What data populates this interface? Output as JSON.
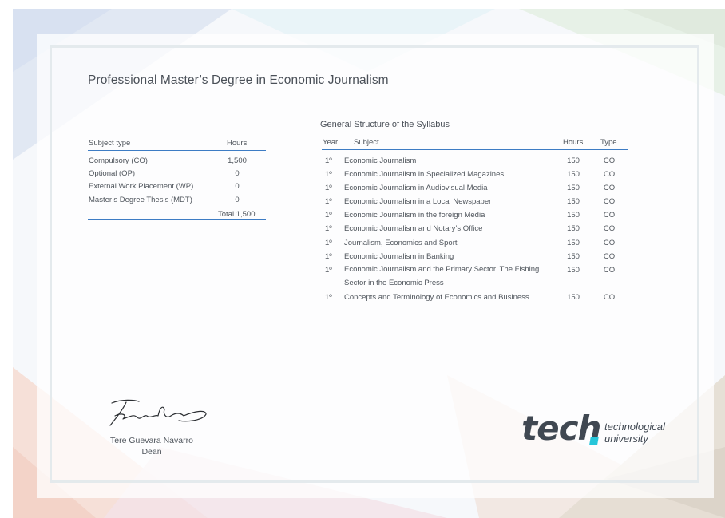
{
  "document": {
    "title": "Professional Master’s Degree in Economic Journalism"
  },
  "subject_summary": {
    "headers": {
      "type": "Subject type",
      "hours": "Hours"
    },
    "rows": [
      {
        "type": "Compulsory (CO)",
        "hours": "1,500"
      },
      {
        "type": "Optional (OP)",
        "hours": "0"
      },
      {
        "type": "External Work Placement (WP)",
        "hours": "0"
      },
      {
        "type": "Master’s Degree Thesis (MDT)",
        "hours": "0"
      }
    ],
    "total": "Total 1,500"
  },
  "syllabus": {
    "title": "General Structure of the Syllabus",
    "headers": {
      "year": "Year",
      "subject": "Subject",
      "hours": "Hours",
      "type": "Type"
    },
    "rows": [
      {
        "year": "1º",
        "subject": "Economic Journalism",
        "hours": "150",
        "type": "CO"
      },
      {
        "year": "1º",
        "subject": "Economic Journalism in Specialized Magazines",
        "hours": "150",
        "type": "CO"
      },
      {
        "year": "1º",
        "subject": "Economic Journalism in Audiovisual Media",
        "hours": "150",
        "type": "CO"
      },
      {
        "year": "1º",
        "subject": "Economic Journalism in a Local Newspaper",
        "hours": "150",
        "type": "CO"
      },
      {
        "year": "1º",
        "subject": "Economic Journalism in the foreign Media",
        "hours": "150",
        "type": "CO"
      },
      {
        "year": "1º",
        "subject": "Economic Journalism and Notary’s Office",
        "hours": "150",
        "type": "CO"
      },
      {
        "year": "1º",
        "subject": "Journalism, Economics and Sport",
        "hours": "150",
        "type": "CO"
      },
      {
        "year": "1º",
        "subject": "Economic Journalism in Banking",
        "hours": "150",
        "type": "CO"
      },
      {
        "year": "1º",
        "subject": "Economic Journalism and the Primary Sector. The Fishing Sector in the Economic Press",
        "hours": "150",
        "type": "CO"
      },
      {
        "year": "1º",
        "subject": "Concepts and Terminology of Economics and Business",
        "hours": "150",
        "type": "CO"
      }
    ]
  },
  "signatory": {
    "name": "Tere Guevara Navarro",
    "role": "Dean"
  },
  "logo": {
    "wordmark": "tech",
    "line1": "technological",
    "line2": "university",
    "accent_color": "#26c6da"
  },
  "colors": {
    "rule": "#3d7cc4",
    "text": "#4f555c"
  }
}
